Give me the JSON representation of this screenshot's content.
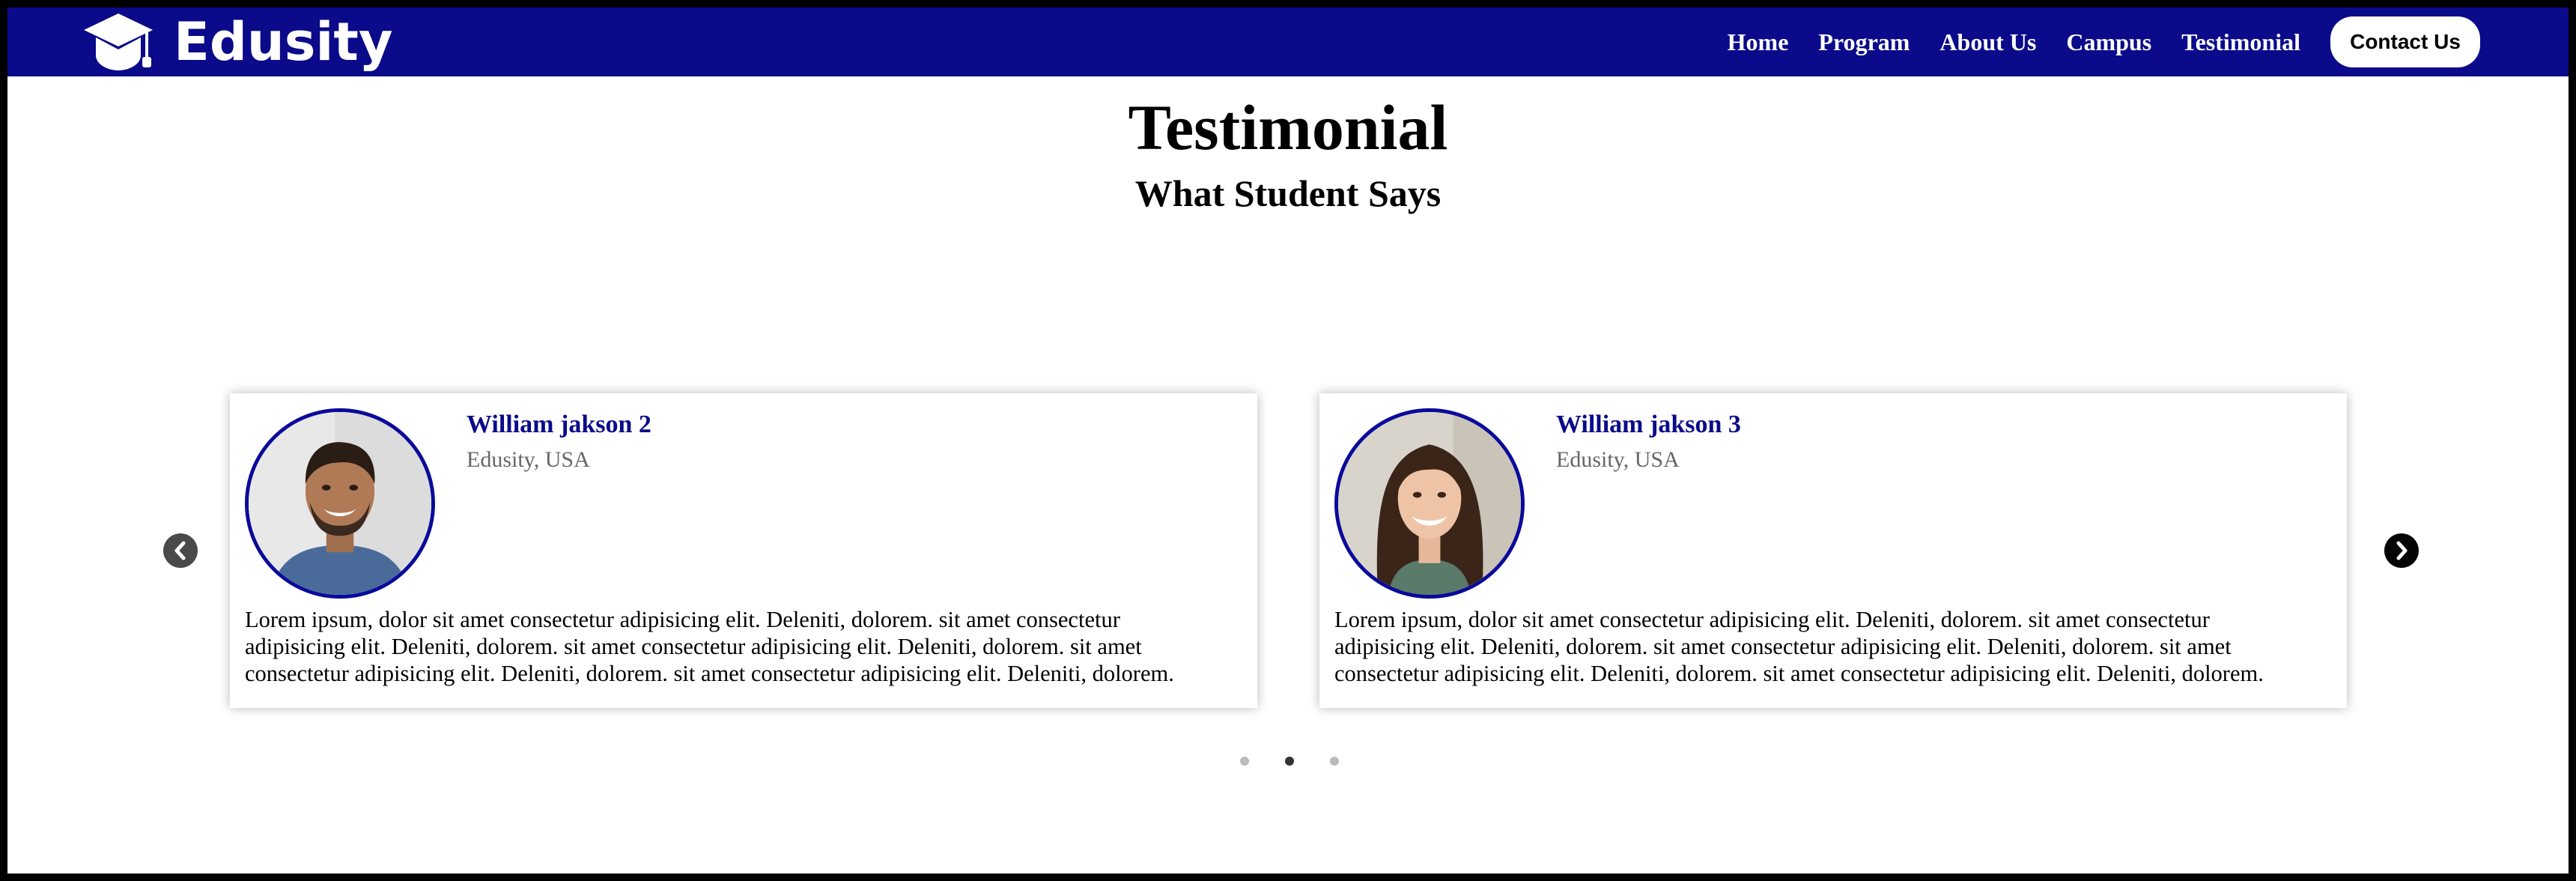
{
  "brand": {
    "name": "Edusity"
  },
  "nav": {
    "links": [
      "Home",
      "Program",
      "About Us",
      "Campus",
      "Testimonial"
    ],
    "contact_label": "Contact Us"
  },
  "section": {
    "title": "Testimonial",
    "subtitle": "What Student Says"
  },
  "testimonials": [
    {
      "name": "William jakson 2",
      "location": "Edusity, USA",
      "text": "Lorem ipsum, dolor sit amet consectetur adipisicing elit. Deleniti, dolorem. sit amet consectetur adipisicing elit. Deleniti, dolorem. sit amet consectetur adipisicing elit. Deleniti, dolorem. sit amet consectetur adipisicing elit. Deleniti, dolorem. sit amet consectetur adipisicing elit. Deleniti, dolorem."
    },
    {
      "name": "William jakson 3",
      "location": "Edusity, USA",
      "text": "Lorem ipsum, dolor sit amet consectetur adipisicing elit. Deleniti, dolorem. sit amet consectetur adipisicing elit. Deleniti, dolorem. sit amet consectetur adipisicing elit. Deleniti, dolorem. sit amet consectetur adipisicing elit. Deleniti, dolorem. sit amet consectetur adipisicing elit. Deleniti, dolorem."
    }
  ],
  "slider": {
    "dot_count": 3,
    "active_dot": 2
  },
  "icons": {
    "prev": "chevron-left-icon",
    "next": "chevron-right-icon",
    "logo": "graduation-cap-icon"
  },
  "colors": {
    "nav_bg": "#0a0a8a",
    "accent": "#0a0a8a",
    "name_color": "#0a0a8a"
  }
}
